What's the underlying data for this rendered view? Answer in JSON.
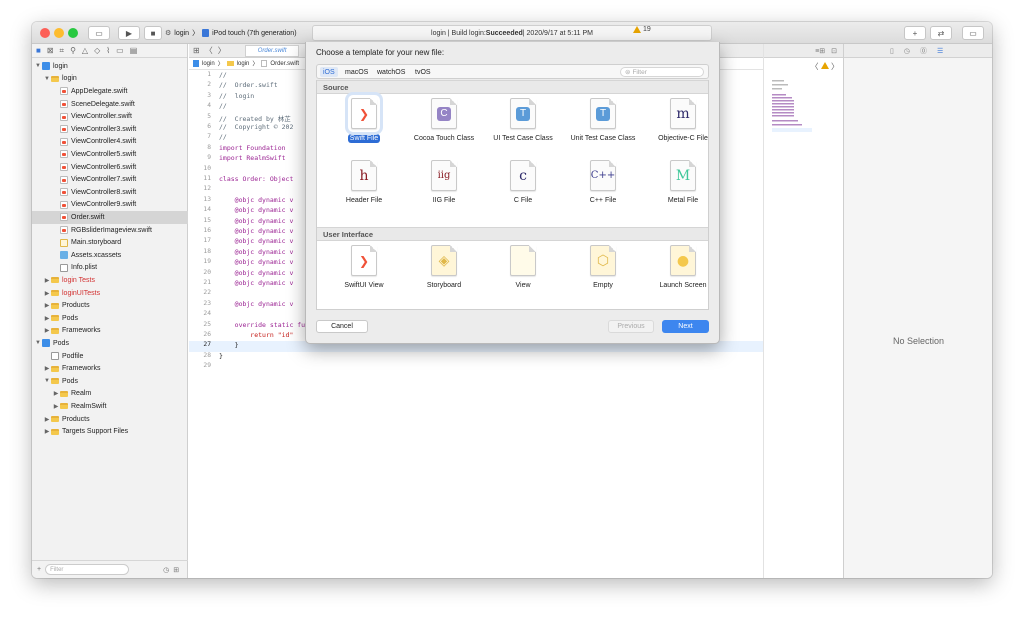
{
  "titlebar": {
    "scheme": "login",
    "device": "iPod touch (7th generation)",
    "activity_prefix": "login | Build login: ",
    "activity_status": "Succeeded",
    "activity_time": " | 2020/9/17 at 5:11 PM",
    "warning_count": "19"
  },
  "navigator": {
    "rows": [
      {
        "label": "login",
        "depth": 0,
        "disclosure": "▼",
        "icon": "proj",
        "red": false
      },
      {
        "label": "login",
        "depth": 1,
        "disclosure": "▼",
        "icon": "folder",
        "red": false
      },
      {
        "label": "AppDelegate.swift",
        "depth": 2,
        "disclosure": "",
        "icon": "swift",
        "red": false
      },
      {
        "label": "SceneDelegate.swift",
        "depth": 2,
        "disclosure": "",
        "icon": "swift",
        "red": false
      },
      {
        "label": "ViewController.swift",
        "depth": 2,
        "disclosure": "",
        "icon": "swift",
        "red": false
      },
      {
        "label": "ViewController3.swift",
        "depth": 2,
        "disclosure": "",
        "icon": "swift",
        "red": false
      },
      {
        "label": "ViewController4.swift",
        "depth": 2,
        "disclosure": "",
        "icon": "swift",
        "red": false
      },
      {
        "label": "ViewController5.swift",
        "depth": 2,
        "disclosure": "",
        "icon": "swift",
        "red": false
      },
      {
        "label": "ViewController6.swift",
        "depth": 2,
        "disclosure": "",
        "icon": "swift",
        "red": false
      },
      {
        "label": "ViewController7.swift",
        "depth": 2,
        "disclosure": "",
        "icon": "swift",
        "red": false
      },
      {
        "label": "ViewController8.swift",
        "depth": 2,
        "disclosure": "",
        "icon": "swift",
        "red": false
      },
      {
        "label": "ViewController9.swift",
        "depth": 2,
        "disclosure": "",
        "icon": "swift",
        "red": false
      },
      {
        "label": "Order.swift",
        "depth": 2,
        "disclosure": "",
        "icon": "swift",
        "red": false,
        "selected": true
      },
      {
        "label": "RGBsliderImageview.swift",
        "depth": 2,
        "disclosure": "",
        "icon": "swift",
        "red": false
      },
      {
        "label": "Main.storyboard",
        "depth": 2,
        "disclosure": "",
        "icon": "story",
        "red": false
      },
      {
        "label": "Assets.xcassets",
        "depth": 2,
        "disclosure": "",
        "icon": "assets",
        "red": false
      },
      {
        "label": "Info.plist",
        "depth": 2,
        "disclosure": "",
        "icon": "plist",
        "red": false
      },
      {
        "label": "login Tests",
        "depth": 1,
        "disclosure": "▶",
        "icon": "folder",
        "red": true
      },
      {
        "label": "loginUITests",
        "depth": 1,
        "disclosure": "▶",
        "icon": "folder",
        "red": true
      },
      {
        "label": "Products",
        "depth": 1,
        "disclosure": "▶",
        "icon": "folder",
        "red": false
      },
      {
        "label": "Pods",
        "depth": 1,
        "disclosure": "▶",
        "icon": "folder",
        "red": false
      },
      {
        "label": "Frameworks",
        "depth": 1,
        "disclosure": "▶",
        "icon": "folder",
        "red": false
      },
      {
        "label": "Pods",
        "depth": 0,
        "disclosure": "▼",
        "icon": "proj",
        "red": false
      },
      {
        "label": "Podfile",
        "depth": 1,
        "disclosure": "",
        "icon": "plist",
        "red": false
      },
      {
        "label": "Frameworks",
        "depth": 1,
        "disclosure": "▶",
        "icon": "folder",
        "red": false
      },
      {
        "label": "Pods",
        "depth": 1,
        "disclosure": "▼",
        "icon": "folder",
        "red": false
      },
      {
        "label": "Realm",
        "depth": 2,
        "disclosure": "▶",
        "icon": "folder",
        "red": false
      },
      {
        "label": "RealmSwift",
        "depth": 2,
        "disclosure": "▶",
        "icon": "folder",
        "red": false
      },
      {
        "label": "Products",
        "depth": 1,
        "disclosure": "▶",
        "icon": "folder",
        "red": false
      },
      {
        "label": "Targets Support Files",
        "depth": 1,
        "disclosure": "▶",
        "icon": "folder",
        "red": false
      }
    ],
    "filter_placeholder": "Filter"
  },
  "editor": {
    "tab": "Order.swift",
    "jump": [
      "login",
      "login",
      "Order.swift"
    ],
    "line_numbers": [
      "1",
      "2",
      "3",
      "4",
      "5",
      "6",
      "7",
      "8",
      "9",
      "10",
      "11",
      "12",
      "13",
      "14",
      "15",
      "16",
      "17",
      "18",
      "19",
      "20",
      "21",
      "22",
      "23",
      "24",
      "25",
      "26",
      "27",
      "28",
      "29"
    ],
    "lines": [
      "//",
      "//  Order.swift",
      "//  login",
      "//",
      "//  Created by 林芷",
      "//  Copyright © 202",
      "//",
      "import Foundation",
      "import RealmSwift",
      "",
      "class Order: Object",
      "",
      "    @objc dynamic v",
      "    @objc dynamic v",
      "    @objc dynamic v",
      "    @objc dynamic v",
      "    @objc dynamic v",
      "    @objc dynamic v",
      "    @objc dynamic v",
      "    @objc dynamic v",
      "    @objc dynamic v",
      "",
      "    @objc dynamic v",
      "",
      "    override static func primaryKey() -> String? {",
      "        return \"id\"",
      "    }",
      "}",
      ""
    ],
    "current_line": "27"
  },
  "inspector": {
    "empty_text": "No Selection"
  },
  "sheet": {
    "title": "Choose a template for your new file:",
    "platforms": [
      "iOS",
      "macOS",
      "watchOS",
      "tvOS"
    ],
    "active_platform": "iOS",
    "filter_placeholder": "Filter",
    "source_header": "Source",
    "ui_header": "User Interface",
    "source_templates": [
      {
        "label": "Swift File",
        "glyph": "swift",
        "selected": true
      },
      {
        "label": "Cocoa Touch Class",
        "glyph": "C",
        "selected": false
      },
      {
        "label": "UI Test Case Class",
        "glyph": "T",
        "selected": false
      },
      {
        "label": "Unit Test Case Class",
        "glyph": "T",
        "selected": false
      },
      {
        "label": "Objective-C File",
        "glyph": "m",
        "selected": false
      },
      {
        "label": "Header File",
        "glyph": "h",
        "selected": false
      },
      {
        "label": "IIG File",
        "glyph": "iig",
        "selected": false
      },
      {
        "label": "C File",
        "glyph": "c",
        "selected": false
      },
      {
        "label": "C++ File",
        "glyph": "C++",
        "selected": false
      },
      {
        "label": "Metal File",
        "glyph": "M",
        "selected": false
      }
    ],
    "ui_templates": [
      {
        "label": "SwiftUI View",
        "glyph": "swift"
      },
      {
        "label": "Storyboard",
        "glyph": "story"
      },
      {
        "label": "View",
        "glyph": "view"
      },
      {
        "label": "Empty",
        "glyph": "empty"
      },
      {
        "label": "Launch Screen",
        "glyph": "launch"
      }
    ],
    "cancel": "Cancel",
    "previous": "Previous",
    "next": "Next"
  },
  "colors": {
    "accent": "#2d6cd5",
    "warning": "#e7a400",
    "swift": "#f05138",
    "objc": "#2e2a6a",
    "header": "#8a1c24",
    "cpp": "#3a3a8c",
    "metal": "#3fc79a"
  }
}
